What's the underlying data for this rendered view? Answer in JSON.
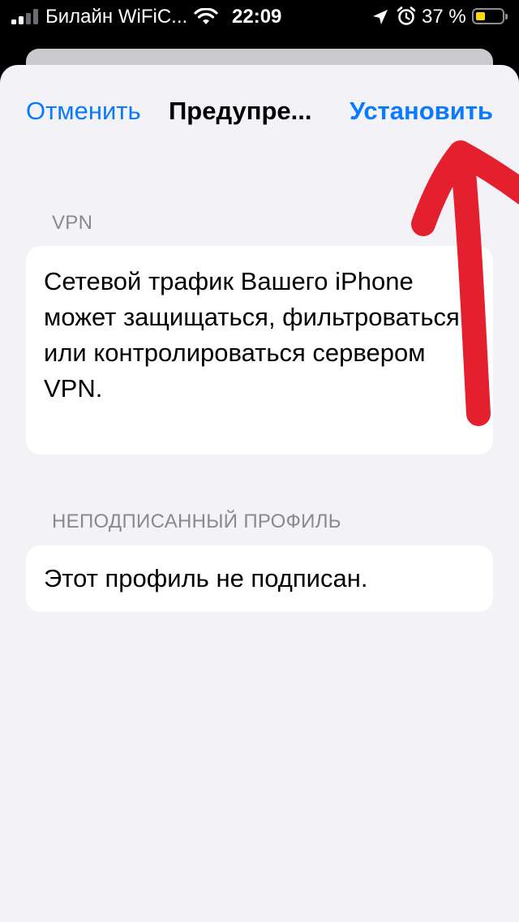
{
  "status_bar": {
    "carrier": "Билайн WiFiC...",
    "time": "22:09",
    "battery_percent": "37 %",
    "battery_level": 0.37,
    "battery_color": "#ffd60a",
    "icons": [
      "signal-icon",
      "wifi-icon",
      "location-icon",
      "alarm-icon",
      "battery-icon"
    ]
  },
  "nav": {
    "cancel_label": "Отменить",
    "title": "Предупре...",
    "install_label": "Установить",
    "accent_color": "#0a7aff"
  },
  "sections": [
    {
      "header": "VPN",
      "text": "Сетевой трафик Вашего iPhone может защищаться, фильтроваться или контролироваться сервером VPN."
    },
    {
      "header": "НЕПОДПИСАННЫЙ ПРОФИЛЬ",
      "text": "Этот профиль не подписан."
    }
  ],
  "annotation": {
    "type": "hand-drawn-arrow",
    "color": "#e5202e",
    "points_to": "install-button"
  }
}
